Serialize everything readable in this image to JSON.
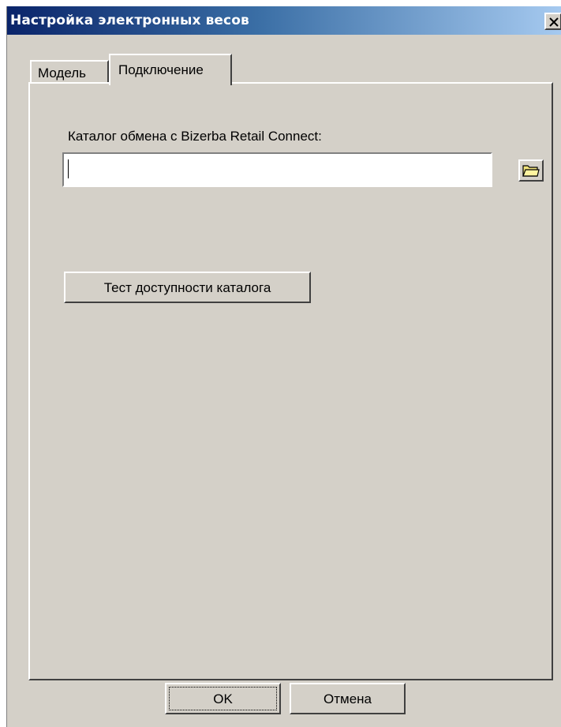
{
  "window": {
    "title": "Настройка электронных весов"
  },
  "tabs": [
    {
      "label": "Модель",
      "active": false
    },
    {
      "label": "Подключение",
      "active": true
    }
  ],
  "connection": {
    "catalog_label": "Каталог обмена с Bizerba Retail Connect:",
    "catalog_path_value": "",
    "test_button_label": "Тест доступности каталога"
  },
  "footer": {
    "ok_label": "OK",
    "cancel_label": "Отмена"
  },
  "icons": {
    "close": "close-icon",
    "browse": "folder-icon"
  },
  "colors": {
    "titlebar_start": "#0a246a",
    "titlebar_end": "#a6caf0",
    "dialog_face": "#d4d0c8"
  }
}
